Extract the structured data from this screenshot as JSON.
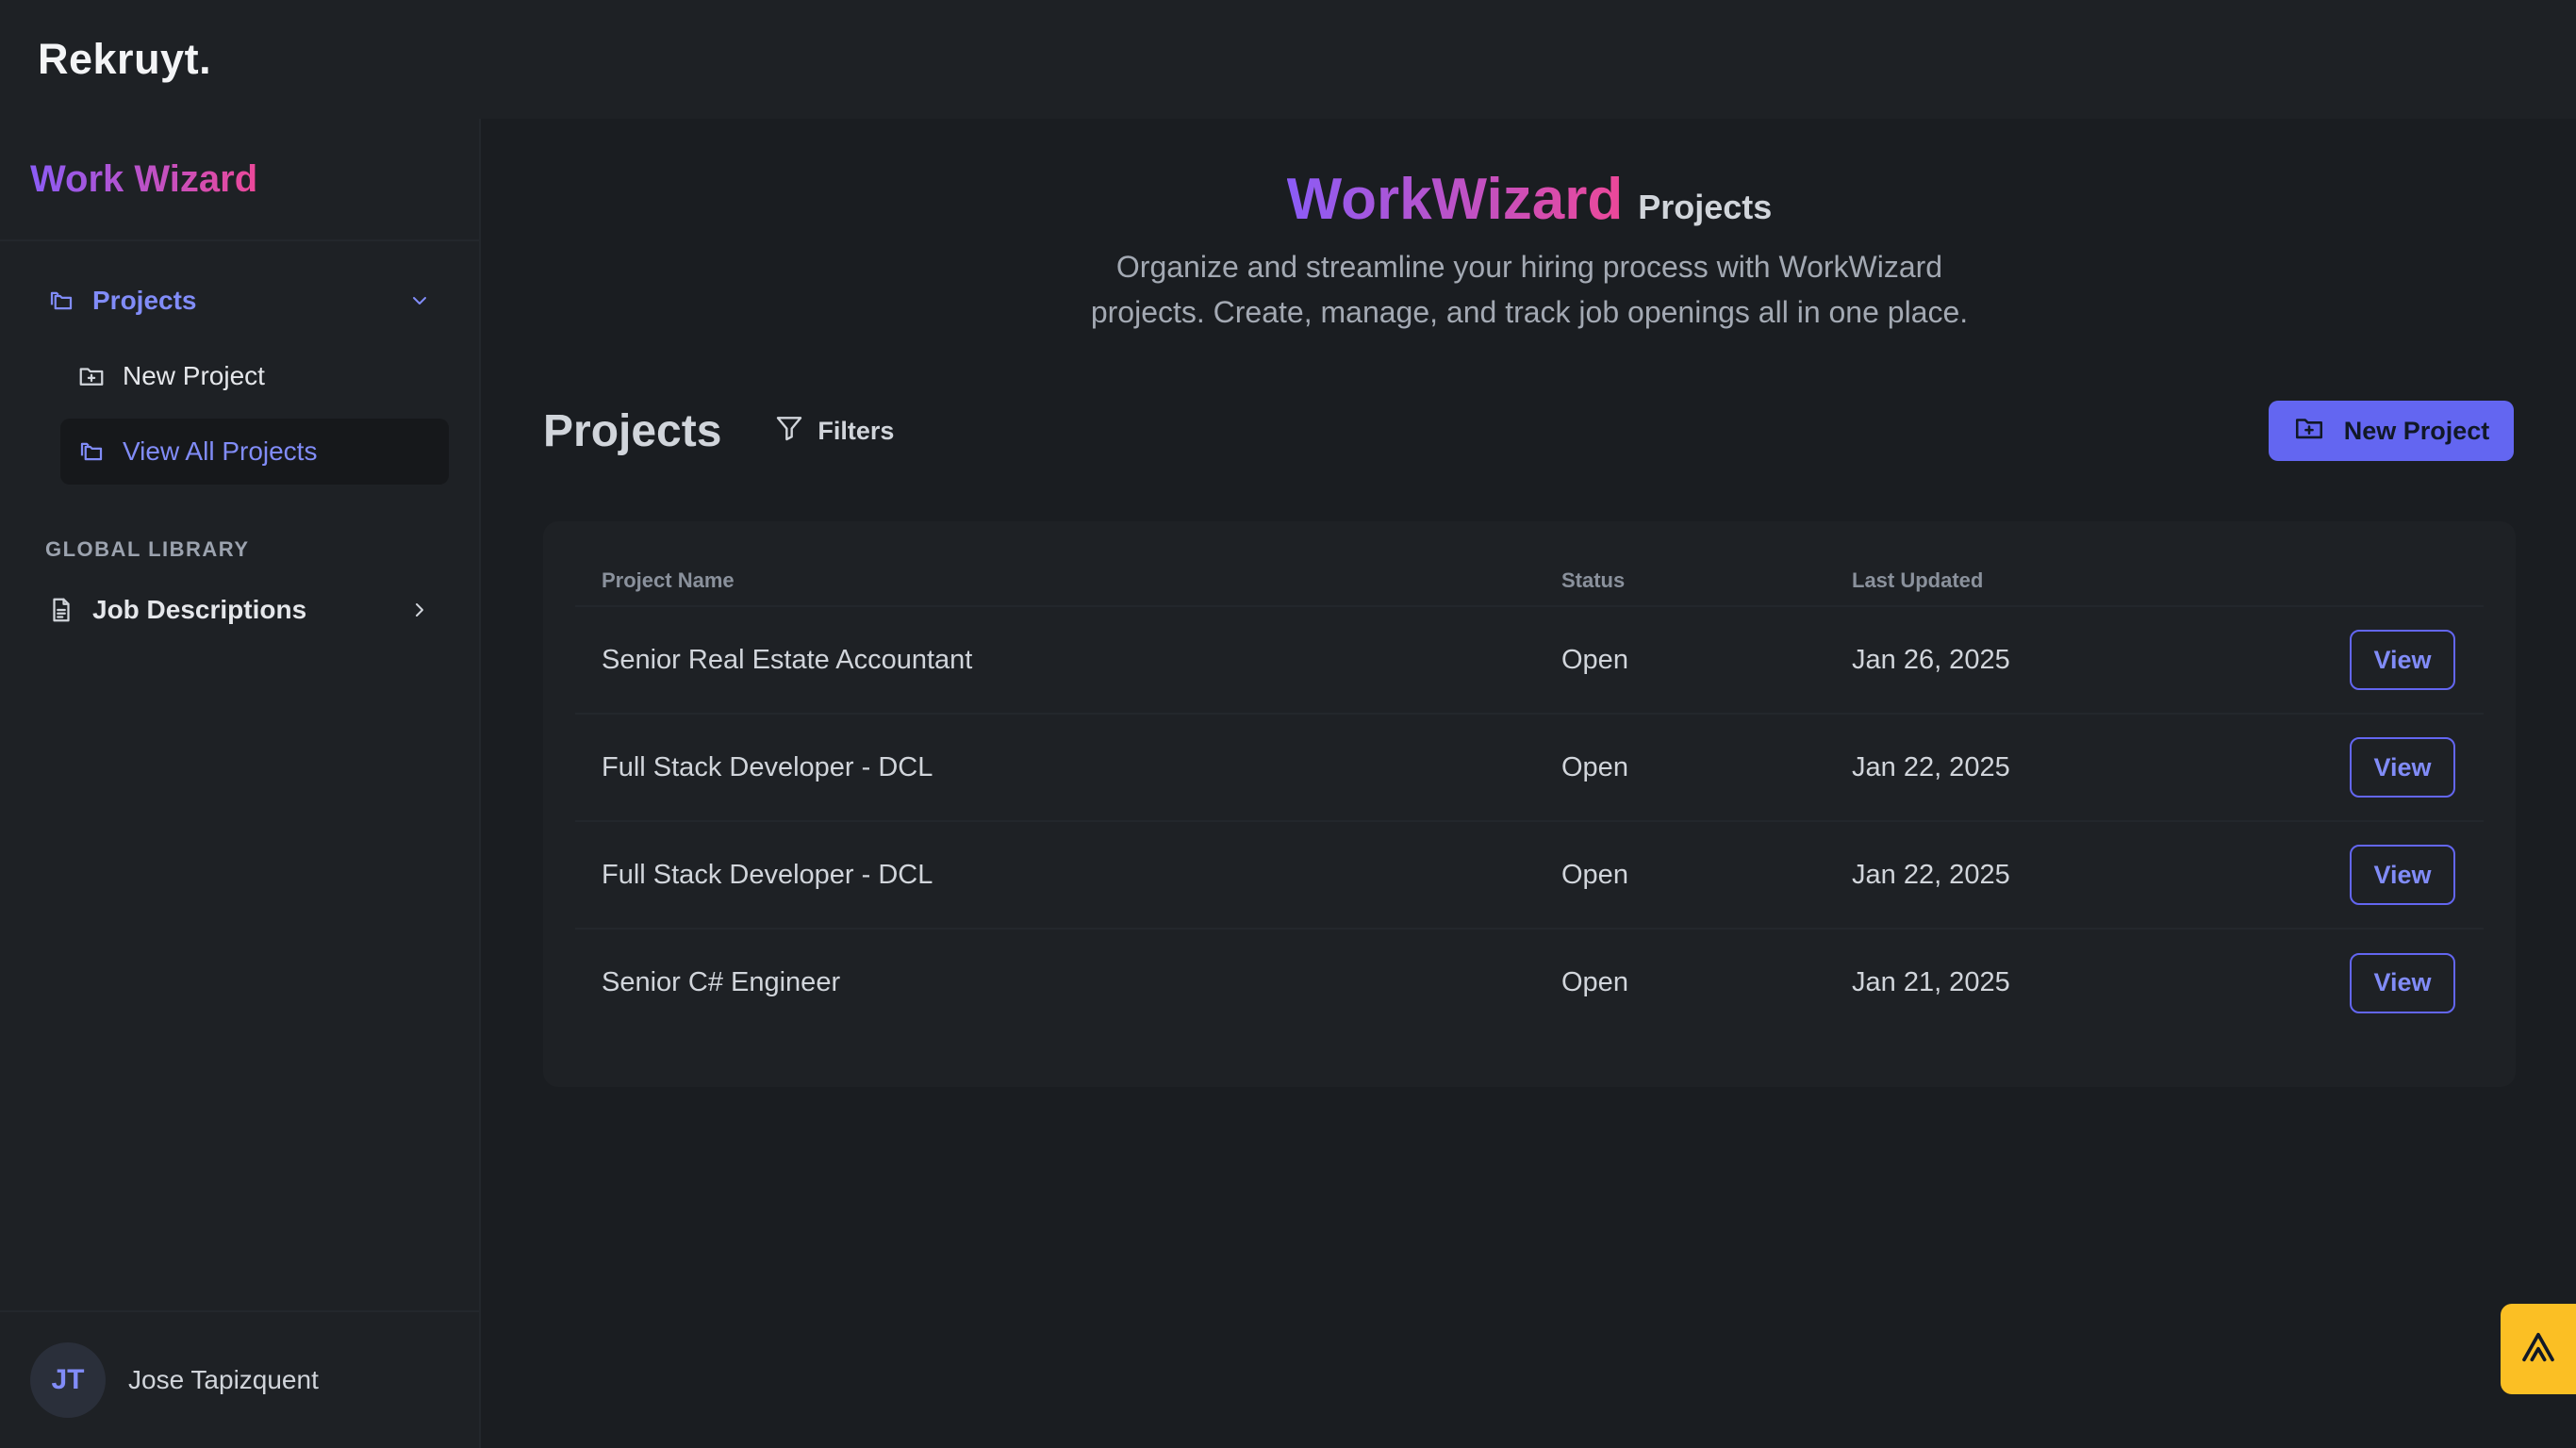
{
  "app": {
    "logo": "Rekruyt."
  },
  "sidebar": {
    "brand": "Work Wizard",
    "nav": {
      "projects_label": "Projects",
      "sub_items": [
        {
          "label": "New Project",
          "icon": "folder-plus-icon"
        },
        {
          "label": "View All Projects",
          "icon": "folders-icon",
          "selected": true
        }
      ]
    },
    "global_library": {
      "section_label": "GLOBAL LIBRARY",
      "job_descriptions_label": "Job Descriptions"
    },
    "user": {
      "initials": "JT",
      "name": "Jose Tapizquent"
    }
  },
  "hero": {
    "title": "WorkWizard",
    "subtitle": "Projects",
    "description": "Organize and streamline your hiring process with WorkWizard projects. Create, manage, and track job openings all in one place."
  },
  "toolbar": {
    "heading": "Projects",
    "filters_label": "Filters",
    "new_project_label": "New Project"
  },
  "table": {
    "columns": [
      "Project Name",
      "Status",
      "Last Updated",
      ""
    ],
    "rows": [
      {
        "name": "Senior Real Estate Accountant",
        "status": "Open",
        "updated": "Jan 26, 2025",
        "action": "View"
      },
      {
        "name": "Full Stack Developer - DCL",
        "status": "Open",
        "updated": "Jan 22, 2025",
        "action": "View"
      },
      {
        "name": "Full Stack Developer - DCL",
        "status": "Open",
        "updated": "Jan 22, 2025",
        "action": "View"
      },
      {
        "name": "Senior C# Engineer",
        "status": "Open",
        "updated": "Jan 21, 2025",
        "action": "View"
      }
    ]
  },
  "colors": {
    "accent": "#6366f1",
    "accent_light": "#818cf8",
    "gradient_start": "#8b5cf6",
    "gradient_end": "#ec4899",
    "float_button": "#fbbf24",
    "background": "#1a1d21"
  }
}
